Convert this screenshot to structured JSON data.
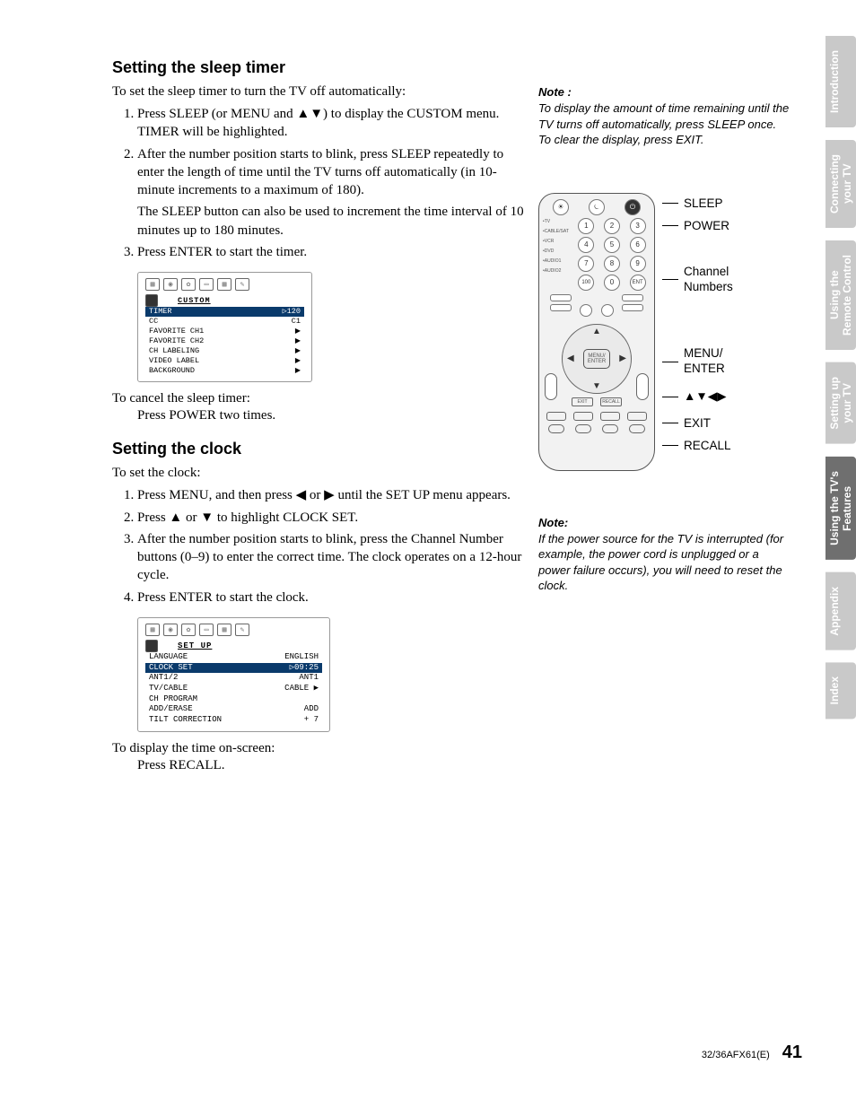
{
  "section1": {
    "heading": "Setting the sleep timer",
    "intro": "To set the sleep timer to turn the TV off automatically:",
    "steps": [
      "Press SLEEP (or MENU and ▲▼) to display the CUSTOM menu. TIMER will be highlighted.",
      "After the number position starts to blink, press SLEEP repeatedly to enter the length of time until the TV turns off automatically (in 10-minute increments to a maximum of 180).",
      "Press ENTER to start the timer."
    ],
    "step2_extra": "The SLEEP button can also be used to increment the time interval of 10 minutes up to 180 minutes.",
    "cancel_intro": "To cancel the sleep timer:",
    "cancel_step": "Press POWER two times."
  },
  "menu1": {
    "title": "CUSTOM",
    "rows": [
      {
        "l": "TIMER",
        "r": "▷120",
        "hl": true
      },
      {
        "l": "CC",
        "r": "C1"
      },
      {
        "l": "FAVORITE CH1",
        "r": "▶"
      },
      {
        "l": "FAVORITE CH2",
        "r": "▶"
      },
      {
        "l": "CH LABELING",
        "r": "▶"
      },
      {
        "l": "VIDEO LABEL",
        "r": "▶"
      },
      {
        "l": "BACKGROUND",
        "r": "▶"
      }
    ]
  },
  "section2": {
    "heading": "Setting the clock",
    "intro": "To set the clock:",
    "steps": [
      "Press MENU, and then press ◀ or ▶ until the SET UP menu appears.",
      "Press ▲ or ▼ to highlight CLOCK SET.",
      "After the number position starts to blink, press the Channel Number buttons (0–9) to enter the correct time. The clock operates on a 12-hour cycle.",
      "Press ENTER to start the clock."
    ],
    "display_intro": "To display the time on-screen:",
    "display_step": "Press RECALL."
  },
  "menu2": {
    "title": "SET UP",
    "rows": [
      {
        "l": "LANGUAGE",
        "r": "ENGLISH"
      },
      {
        "l": "CLOCK SET",
        "r": "▷09:25",
        "hl": true
      },
      {
        "l": "ANT1/2",
        "r": "ANT1"
      },
      {
        "l": "TV/CABLE",
        "r": "CABLE   ▶"
      },
      {
        "l": "CH PROGRAM",
        "r": ""
      },
      {
        "l": "ADD/ERASE",
        "r": "ADD"
      },
      {
        "l": "TILT CORRECTION",
        "r": "+ 7"
      }
    ]
  },
  "note1": {
    "title": "Note :",
    "body": "To display the amount of time remaining until the TV turns off automatically, press SLEEP once. To clear the display, press EXIT."
  },
  "note2": {
    "title": "Note:",
    "body": "If the power source for the TV is interrupted (for example, the power cord is unplugged or a power failure occurs), you will need to reset the clock."
  },
  "remote": {
    "callouts": {
      "sleep": "SLEEP",
      "power": "POWER",
      "chan": "Channel\nNumbers",
      "menu": "MENU/\nENTER",
      "arrows": "▲▼◀▶",
      "exit": "EXIT",
      "recall": "RECALL"
    },
    "side_labels": "•TV\n•CABLE/SAT\n•VCR\n•DVD\n•AUDIO1\n•AUDIO2",
    "center": "MENU/\nENTER",
    "below": {
      "exit": "EXIT",
      "recall": "RECALL"
    }
  },
  "tabs": [
    {
      "main": "Introduction",
      "sub": ""
    },
    {
      "main": "Connecting",
      "sub": "your TV"
    },
    {
      "main": "Using the",
      "sub": "Remote Control"
    },
    {
      "main": "Setting up",
      "sub": "your TV"
    },
    {
      "main": "Using the TV's",
      "sub": "Features",
      "active": true
    },
    {
      "main": "Appendix",
      "sub": ""
    },
    {
      "main": "Index",
      "sub": ""
    }
  ],
  "footer": {
    "doc": "32/36AFX61(E)",
    "page": "41"
  }
}
